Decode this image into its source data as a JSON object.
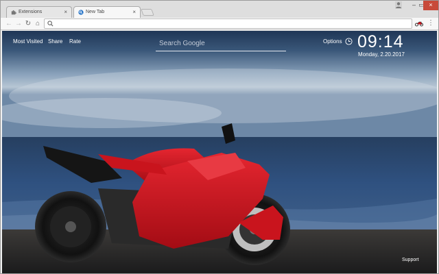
{
  "tabs": [
    {
      "title": "Extensions",
      "close_glyph": "×",
      "icon": "puzzle-icon"
    },
    {
      "title": "New Tab",
      "close_glyph": "×",
      "icon": "new-tab-favicon"
    }
  ],
  "window_controls": {
    "minimize": "–",
    "maximize": "▭",
    "close": "×"
  },
  "toolbar": {
    "back_glyph": "←",
    "forward_glyph": "→",
    "reload_glyph": "↻",
    "home_glyph": "⌂",
    "omnibox_value": "",
    "menu_glyph": "⋮"
  },
  "newtab": {
    "links": {
      "most_visited": "Most Visited",
      "share": "Share",
      "rate": "Rate"
    },
    "search_placeholder": "Search Google",
    "options": "Options",
    "time": "09:14",
    "date": "Monday, 2.20.2017",
    "support": "Support"
  },
  "colors": {
    "sky_top": "#2b4566",
    "sky_mid": "#8fa6bd",
    "sea": "#2e4d76",
    "bike_red": "#c9141d",
    "ground": "#2a2a2c",
    "close_button": "#c84a3a"
  }
}
